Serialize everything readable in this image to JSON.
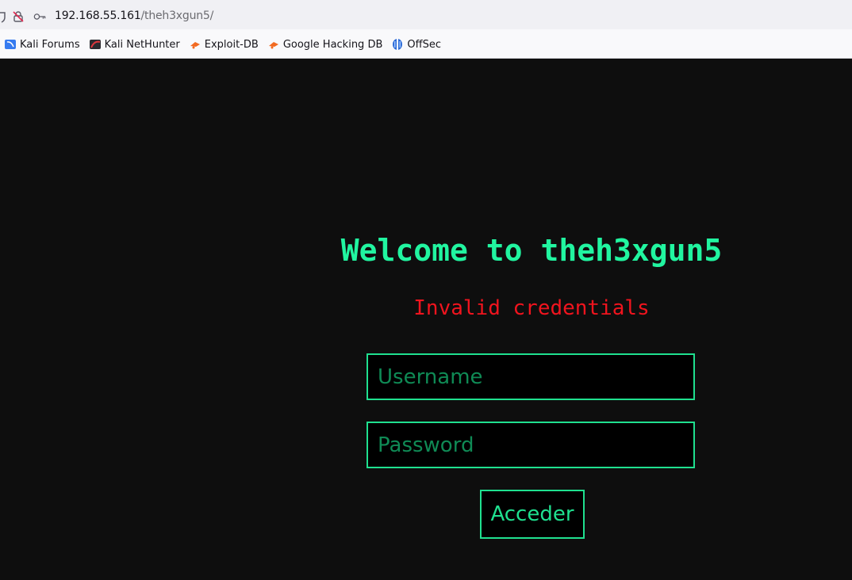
{
  "browser": {
    "url_host": "192.168.55.161",
    "url_path": "/theh3xgun5/",
    "bookmarks": [
      {
        "label": "Kali Forums",
        "icon": "kali-forums-icon"
      },
      {
        "label": "Kali NetHunter",
        "icon": "kali-nethunter-icon"
      },
      {
        "label": "Exploit-DB",
        "icon": "exploit-db-icon"
      },
      {
        "label": "Google Hacking DB",
        "icon": "exploit-db-icon"
      },
      {
        "label": "OffSec",
        "icon": "offsec-icon"
      }
    ]
  },
  "login": {
    "title": "Welcome to theh3xgun5",
    "error": "Invalid credentials",
    "username_placeholder": "Username",
    "password_placeholder": "Password",
    "submit_label": "Acceder"
  },
  "colors": {
    "accent": "#21f5a0",
    "error": "#f0141e",
    "background": "#0e0e0e"
  }
}
